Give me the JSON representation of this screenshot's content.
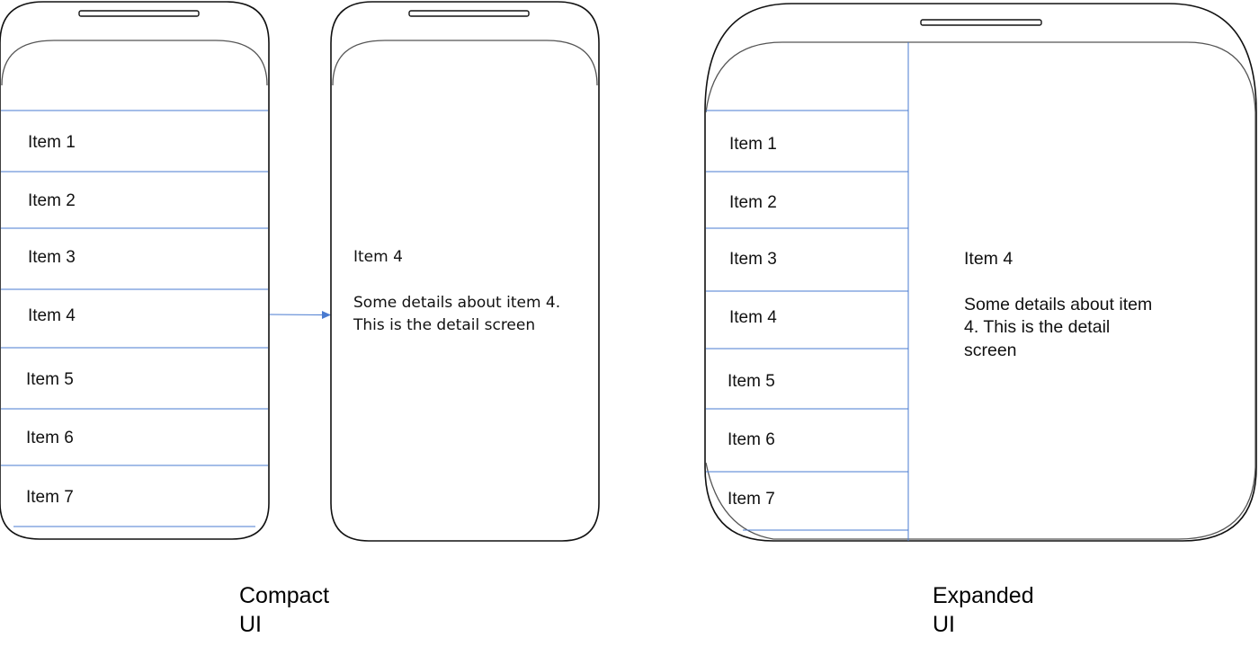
{
  "compact": {
    "list_items": [
      "Item 1",
      "Item 2",
      "Item 3",
      "Item 4",
      "Item 5",
      "Item 6",
      "Item 7"
    ],
    "detail": {
      "title": "Item 4",
      "body_lines": [
        "Some details about item 4.",
        "This is the detail screen"
      ]
    },
    "caption_lines": [
      "Compact",
      "UI"
    ]
  },
  "expanded": {
    "list_items": [
      "Item 1",
      "Item 2",
      "Item 3",
      "Item 4",
      "Item 5",
      "Item 6",
      "Item 7"
    ],
    "detail": {
      "title": "Item 4",
      "body_lines": [
        "Some details about item",
        "4. This is the detail",
        "screen"
      ]
    },
    "caption_lines": [
      "Expanded",
      "UI"
    ]
  },
  "colors": {
    "divider": "#4a7bd0",
    "frame": "#111111"
  }
}
